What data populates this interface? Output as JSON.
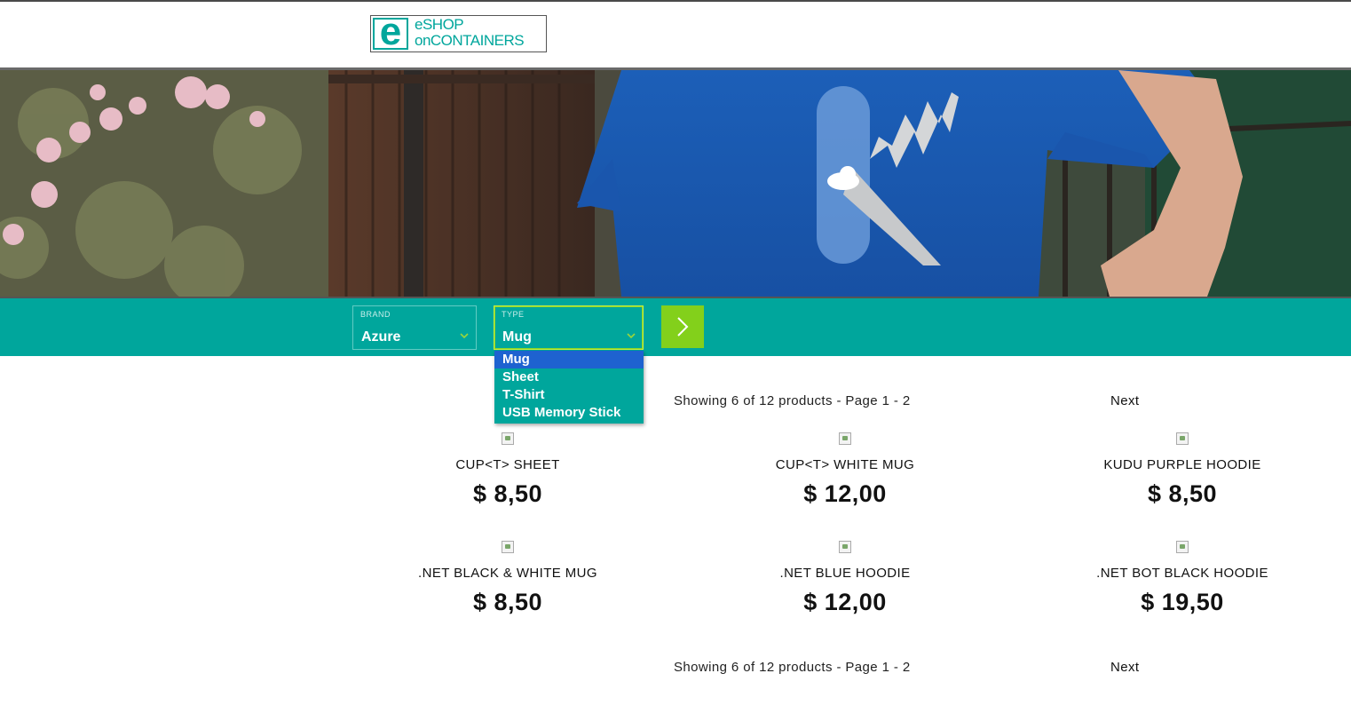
{
  "logo": {
    "mark": "e",
    "line1": "eSHOP",
    "line2": "onCONTAINERS"
  },
  "colors": {
    "accent": "#00a69c",
    "go_button": "#83d01b",
    "selected_option": "#1e62d0"
  },
  "filters": {
    "brand": {
      "label": "BRAND",
      "value": "Azure"
    },
    "type": {
      "label": "TYPE",
      "value": "Mug"
    },
    "go_icon": "chevron-right-icon"
  },
  "type_dropdown": {
    "options": [
      "Mug",
      "Sheet",
      "T-Shirt",
      "USB Memory Stick"
    ],
    "selected_index": 0
  },
  "pager_top": {
    "status": "Showing 6 of 12 products - Page 1 - 2",
    "next": "Next"
  },
  "pager_bottom": {
    "status": "Showing 6 of 12 products - Page 1 - 2",
    "next": "Next"
  },
  "products": [
    {
      "name": "CUP<T> SHEET",
      "price": "$ 8,50"
    },
    {
      "name": "CUP<T> WHITE MUG",
      "price": "$ 12,00"
    },
    {
      "name": "KUDU PURPLE HOODIE",
      "price": "$ 8,50"
    },
    {
      "name": ".NET BLACK & WHITE MUG",
      "price": "$ 8,50"
    },
    {
      "name": ".NET BLUE HOODIE",
      "price": "$ 12,00"
    },
    {
      "name": ".NET BOT BLACK HOODIE",
      "price": "$ 19,50"
    }
  ]
}
